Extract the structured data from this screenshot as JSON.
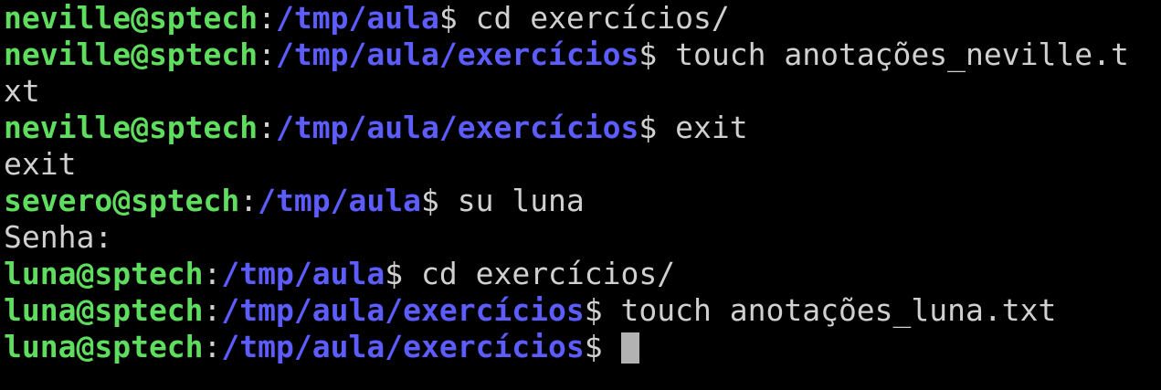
{
  "colors": {
    "background": "#000000",
    "user_host": "#5fdd5f",
    "path": "#5c5cff",
    "text": "#d0d0d0",
    "cursor": "#b2b2b2"
  },
  "lines": [
    {
      "user": "neville@sptech",
      "path": "/tmp/aula",
      "cmd": "cd exercícios/"
    },
    {
      "user": "neville@sptech",
      "path": "/tmp/aula/exercícios",
      "cmd": "touch anotações_neville.t"
    },
    {
      "output": "xt"
    },
    {
      "user": "neville@sptech",
      "path": "/tmp/aula/exercícios",
      "cmd": "exit"
    },
    {
      "output": "exit"
    },
    {
      "user": "severo@sptech",
      "path": "/tmp/aula",
      "cmd": "su luna"
    },
    {
      "output": "Senha:"
    },
    {
      "user": "luna@sptech",
      "path": "/tmp/aula",
      "cmd": "cd exercícios/"
    },
    {
      "user": "luna@sptech",
      "path": "/tmp/aula/exercícios",
      "cmd": "touch anotações_luna.txt"
    },
    {
      "user": "luna@sptech",
      "path": "/tmp/aula/exercícios",
      "cmd": ""
    }
  ],
  "symbols": {
    "colon": ":",
    "dollar": "$"
  }
}
